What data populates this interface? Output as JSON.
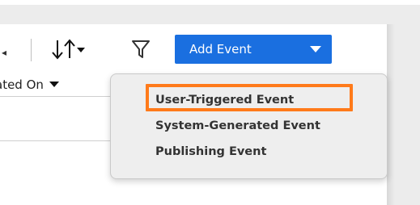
{
  "toolbar": {
    "sort_icon": "sort-arrows-icon",
    "sort_caret_icon": "caret-down-icon",
    "filter_icon": "funnel-icon",
    "add_event_label": "Add Event",
    "add_event_caret_icon": "caret-down-icon",
    "accent_color": "#1a6fe0"
  },
  "table": {
    "column_header_label": "ated On",
    "column_header_icon": "caret-down-icon"
  },
  "dropdown": {
    "items": [
      {
        "label": "User-Triggered Event",
        "highlighted": true
      },
      {
        "label": "System-Generated Event",
        "highlighted": false
      },
      {
        "label": "Publishing Event",
        "highlighted": false
      }
    ],
    "highlight_color": "#ff7a1a"
  }
}
